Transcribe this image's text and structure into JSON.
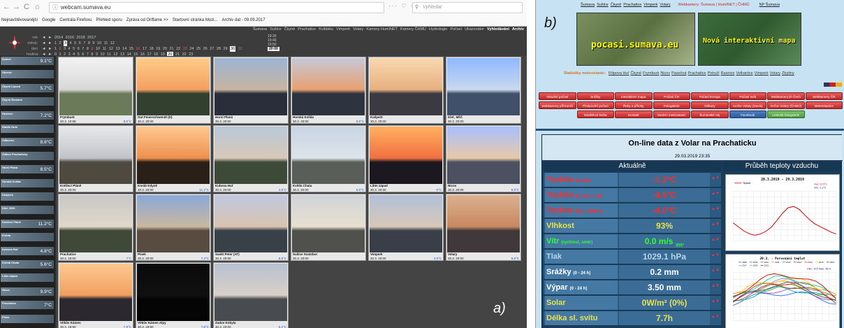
{
  "panel_a": {
    "label": "a)",
    "browser": {
      "nav_icons": [
        "←",
        "→",
        "C",
        "⌂"
      ],
      "url": "webcam.sumava.eu",
      "url_icons": "··· ♡ ☆",
      "search_placeholder": "Vyhledat",
      "bookmarks": [
        "Nejnavštěvovanější",
        "Google",
        "Centrála Firefoxu",
        "Přehled sporu",
        "Zpráva od Oriflame >>",
        "Startovní stránka Mozi...",
        "Archiv dat - 09.09.2017"
      ]
    },
    "topnav": {
      "items": [
        "Šumava",
        "Sušice",
        "Čkyně",
        "Prachatice",
        "Kvildáku",
        "Vimperk",
        "Volary",
        "Kamery HumINET",
        "Kamery ČHMÚ",
        "Hydrologie",
        "Počasí",
        "Ukazovátor",
        "Vyhledávání",
        "Archiv"
      ]
    },
    "controls": {
      "rok": {
        "label": "rok",
        "items": [
          "◄",
          "►",
          "2014",
          "2016",
          "2018",
          "2017"
        ],
        "sel": ""
      },
      "mesic": {
        "label": "měsíc",
        "items": [
          "◄",
          "►",
          "1",
          "2",
          "3",
          "4",
          "5",
          "6",
          "7",
          "8",
          "9",
          "10",
          "11",
          "12"
        ],
        "sel": "3"
      },
      "den": {
        "label": "den",
        "items": [
          "◄",
          "►",
          "1",
          "2",
          "3",
          "4",
          "5",
          "6",
          "7",
          "8",
          "9",
          "10",
          "11",
          "12",
          "13",
          "14",
          "15",
          "16",
          "17",
          "18",
          "19",
          "20",
          "21",
          "22",
          "23",
          "24",
          "25",
          "26",
          "27",
          "28",
          "29",
          "30",
          "31"
        ],
        "sel": "30"
      },
      "hodina": {
        "label": "hodina",
        "items": [
          "◄",
          "►",
          "0",
          "1",
          "2",
          "3",
          "4",
          "5",
          "6",
          "7",
          "8",
          "9",
          "10",
          "11",
          "12",
          "13",
          "14",
          "15",
          "16",
          "17",
          "18",
          "19",
          "20",
          "21",
          "22",
          "23"
        ],
        "sel": "20"
      },
      "times": [
        "19:30",
        "19:40",
        "19:50",
        "20:00"
      ]
    },
    "sidebar": [
      {
        "name": "Sušice",
        "val": "9.1°C"
      },
      {
        "name": "Úborsk",
        "val": ""
      },
      {
        "name": "Čkyně Lipová",
        "val": "5.7°C"
      },
      {
        "name": "Čkyně-Šumava",
        "val": ""
      },
      {
        "name": "Husinec",
        "val": "7.2°C"
      },
      {
        "name": "Stádlé Hutě",
        "val": ""
      },
      {
        "name": "Zdíkovec",
        "val": "8.6°C"
      },
      {
        "name": "Zdíkov Prachatický",
        "val": ""
      },
      {
        "name": "Horní Planá",
        "val": "8.5°C"
      },
      {
        "name": "Horská Kvilda",
        "val": ""
      },
      {
        "name": "Kašperk",
        "val": ""
      },
      {
        "name": "Kleť, Mříč",
        "val": ""
      },
      {
        "name": "Kněžecí Pláně",
        "val": "11.2°C"
      },
      {
        "name": "Kvilda",
        "val": ""
      },
      {
        "name": "Kubova Huť",
        "val": "4.8°C"
      },
      {
        "name": "Kvilda Chata",
        "val": "5.6°C"
      },
      {
        "name": "Libín západ",
        "val": ""
      },
      {
        "name": "Nicov",
        "val": "9.9°C"
      },
      {
        "name": "Prachatice",
        "val": "7°C"
      },
      {
        "name": "Písek",
        "val": ""
      }
    ],
    "cams": [
      {
        "name": "Frymburk",
        "time": "30.3. 10:58",
        "temp": "8.6°C"
      },
      {
        "name": "Gut Feuerschwendt (D)",
        "time": "30.3. 20:00",
        "temp": ""
      },
      {
        "name": "Horní Planá",
        "time": "30.3. 20:00",
        "temp": ""
      },
      {
        "name": "Horská Kvilda",
        "time": "30.3. 20:00",
        "temp": "0.6°C"
      },
      {
        "name": "Kašperk",
        "time": "30.3. 20:00",
        "temp": ""
      },
      {
        "name": "Kleť, Mříč",
        "time": "30.3. 20:00",
        "temp": ""
      },
      {
        "name": "Kněžecí Pláně",
        "time": "30.3. 20:00",
        "temp": ""
      },
      {
        "name": "Koráb Kdyně",
        "time": "30.3. 20:00",
        "temp": "11.2°C"
      },
      {
        "name": "Kubova Huť",
        "time": "30.3. 20:00",
        "temp": "4.8°C"
      },
      {
        "name": "Kvilda Chata",
        "time": "30.3. 20:00",
        "temp": "5.6°C"
      },
      {
        "name": "Libín západ",
        "time": "30.3. 20:00",
        "temp": "0°C"
      },
      {
        "name": "Nicov",
        "time": "30.3. 20:00",
        "temp": "9.9°C"
      },
      {
        "name": "Prachatice",
        "time": "30.3. 20:00",
        "temp": "7°C"
      },
      {
        "name": "Písek",
        "time": "30.3. 20:00",
        "temp": "7.4°C"
      },
      {
        "name": "Sankt Peter (AT)",
        "time": "30.3. 20:00",
        "temp": "8.8°C"
      },
      {
        "name": "Sušice Svatobor",
        "time": "30.3. 20:00",
        "temp": ""
      },
      {
        "name": "Vimperk",
        "time": "30.3. 20:00",
        "temp": "4.8°C"
      },
      {
        "name": "Volary",
        "time": "30.3. 20:00",
        "temp": "6.6°C"
      },
      {
        "name": "Vítkův Kámen",
        "time": "30.3. 19:50",
        "temp": "7.8°C"
      },
      {
        "name": "Vítkův Kámen Alpy",
        "time": "30.3. 19:50",
        "temp": "7.8°C"
      },
      {
        "name": "Zadov Kobyla",
        "time": "30.3. 20:00",
        "temp": "6.2°C"
      }
    ]
  },
  "panel_b": {
    "label": "b)",
    "header_links": [
      "Šumava",
      "Sušice",
      "Čkyně",
      "Prachatice",
      "Vimperk",
      "Volary"
    ],
    "header_annot": "Webkamery: Šumava | HumINET | ČHMÚ",
    "header_np": "NP Šumava",
    "banner1": "pocasi.sumava.eu",
    "banner2": "Nová interaktivní mapa",
    "stats_label": "Statistiky meteostanic:",
    "stats_links": [
      "Filipova Huť",
      "Čkyně",
      "Frymburk",
      "Nicov",
      "Pasečná",
      "Prachatice",
      "Pstruží",
      "Rasnice",
      "Velhartice",
      "Vimperk",
      "Volary",
      "Zbytiny"
    ],
    "buttons_row1": [
      "Aktuální počasí",
      "Srážky",
      "Interaktivní mapa",
      "Počasí ČR",
      "Počasí Evropa",
      "Počasí svět",
      "Webkamery jih Čech",
      "Webkamery ČR"
    ],
    "buttons_row2": [
      "Webkamery příhraničí",
      "Předpověď počasí",
      "Řeky a přítoky",
      "Fotogalerie",
      "Odkazy",
      "Archiv Volary (Davis)",
      "Archiv Volary (ČHMÚ)",
      "Meteostanice"
    ],
    "buttons_row3": [
      "Návštěvní kniha",
      "Kontakt",
      "Souhrn meteostanic",
      "Šumavské nej",
      "Facebook",
      "Letecká fotogalerie"
    ],
    "data_title": "On-line data z Volar na Prachaticku",
    "data_date": "29.03.2019 23:35",
    "header_left": "Aktuálně",
    "header_right": "Průběh teploty vzduchu",
    "rows": [
      {
        "label": "Teplota",
        "sub": "(město)",
        "value": "-1.2°C",
        "sub2": "",
        "color": "#ff2a2a"
      },
      {
        "label": "Teplota",
        "sub": "(Luční potok)",
        "value": "-4.5°C",
        "sub2": "",
        "color": "#ff2a2a"
      },
      {
        "label": "Teplota",
        "sub": "(ČOV, ČHMÚ)",
        "value": "-4.0°C",
        "sub2": "",
        "color": "#ff2a2a"
      },
      {
        "label": "Vlhkost",
        "sub": "",
        "value": "93%",
        "sub2": "",
        "color": "#e8e24a"
      },
      {
        "label": "Vítr",
        "sub": "(rychlost, směr)",
        "value": "0.0 m/s",
        "sub2": "355°",
        "color": "#33ff33"
      },
      {
        "label": "Tlak",
        "sub": "",
        "value": "1029.1 hPa",
        "sub2": "",
        "color": "#b7d3ea"
      },
      {
        "label": "Srážky",
        "sub": "(0 - 24 h)",
        "value": "0.2 mm",
        "sub2": "",
        "color": "#ffffff"
      },
      {
        "label": "Výpar",
        "sub": "(0 - 24 h)",
        "value": "3.50 mm",
        "sub2": "",
        "color": "#ffffff"
      },
      {
        "label": "Solar",
        "sub": "",
        "value": "0W/m² (0%)",
        "sub2": "",
        "color": "#e8e24a"
      },
      {
        "label": "Délka sl. svitu",
        "sub": "",
        "value": "7.7h",
        "sub2": "",
        "color": "#e8e24a"
      }
    ],
    "chart1": {
      "title": "28.3.2019 - 29.3.2019",
      "legend": "Teplota",
      "max_label": "max: 12.5°C",
      "min_label": "min: -1.2°C"
    },
    "chart2": {
      "title": "29.3. - Porovnání teplot",
      "legend_years": [
        "2008",
        "2009",
        "2010",
        "2011",
        "2012",
        "2013",
        "2014",
        "2015",
        "2016",
        "2017",
        "2018",
        "2019"
      ],
      "minmax": "min: -4.5  max: 16.4"
    }
  },
  "colors": {
    "dark_bg": "#2b2b2b",
    "accent_red": "#c02828",
    "panel_blue": "#1a3d5c"
  }
}
